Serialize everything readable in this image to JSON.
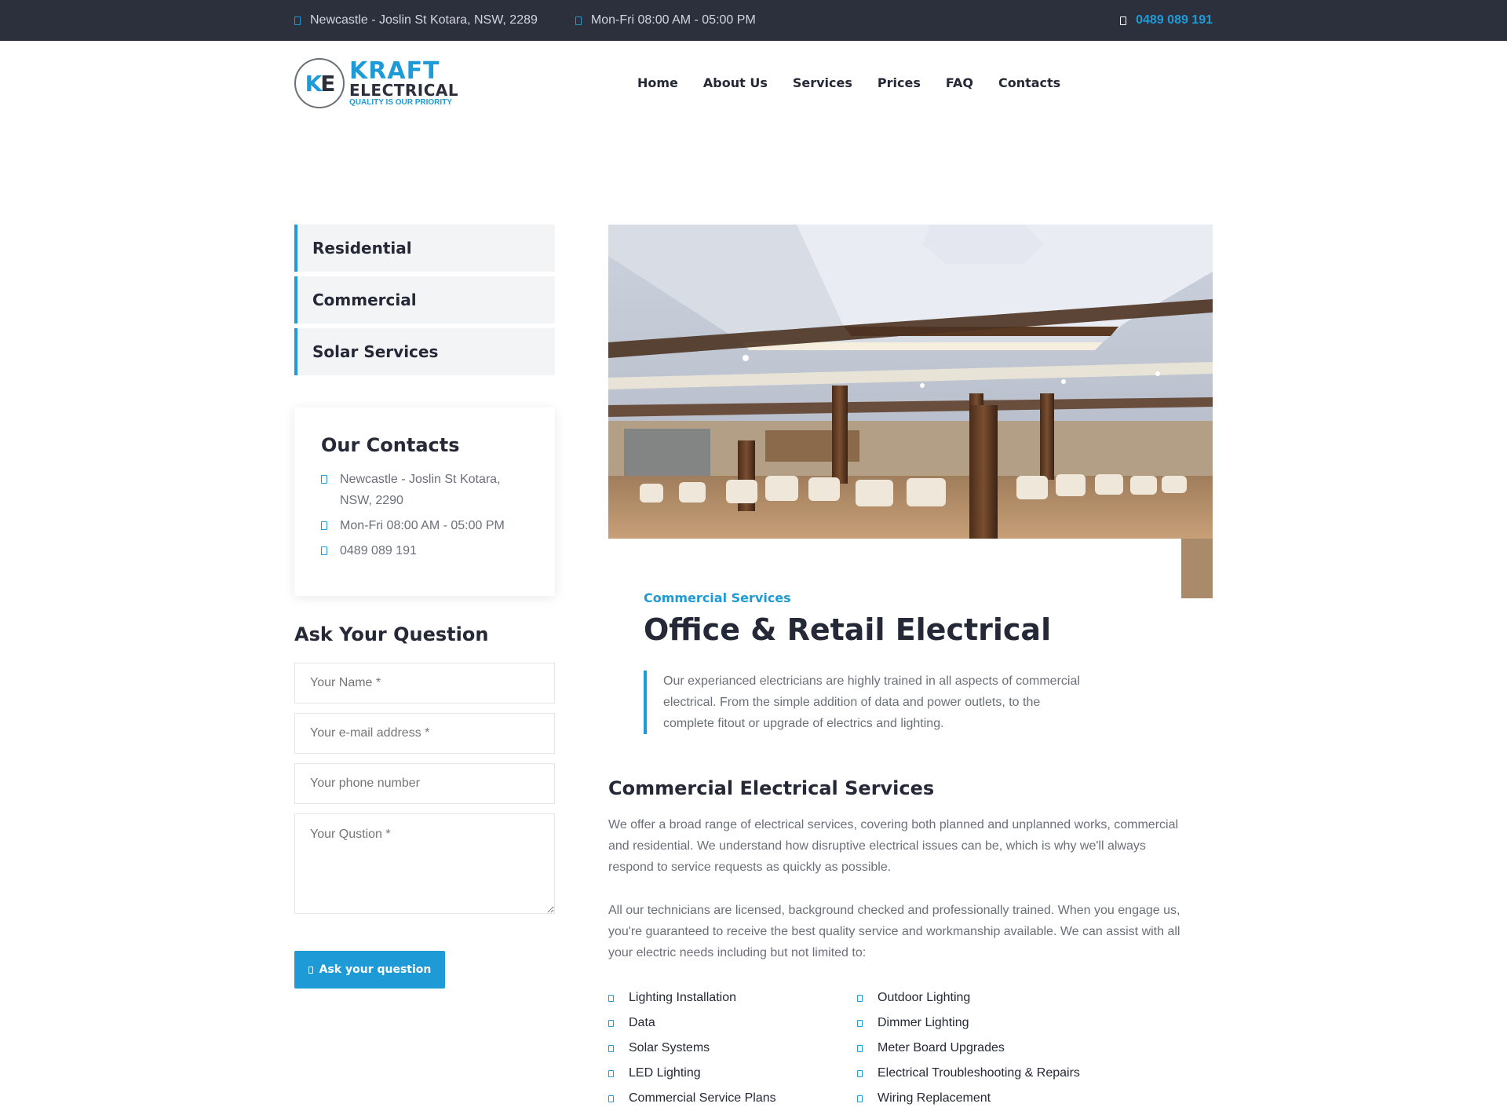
{
  "topbar": {
    "address": "Newcastle - Joslin St Kotara, NSW, 2289",
    "hours": "Mon-Fri 08:00 AM - 05:00 PM",
    "phone": "0489 089 191"
  },
  "logo": {
    "line1": "KRAFT",
    "line2": "ELECTRICAL",
    "line3": "QUALITY IS OUR PRIORITY"
  },
  "nav": [
    "Home",
    "About Us",
    "Services",
    "Prices",
    "FAQ",
    "Contacts"
  ],
  "sidebar": {
    "categories": [
      "Residential",
      "Commercial",
      "Solar Services"
    ],
    "contacts": {
      "title": "Our Contacts",
      "address": "Newcastle - Joslin St Kotara, NSW, 2290",
      "hours": "Mon-Fri 08:00 AM - 05:00 PM",
      "phone": "0489 089 191"
    },
    "form": {
      "title": "Ask Your Question",
      "name_placeholder": "Your Name *",
      "email_placeholder": "Your e-mail address *",
      "phone_placeholder": "Your phone number",
      "question_placeholder": "Your Qustion *",
      "submit_label": "Ask your question"
    }
  },
  "main": {
    "tagline": "Commercial Services",
    "title": "Office & Retail Electrical",
    "quote": "Our experianced electricians are highly trained in all aspects of commercial electrical. From the simple addition of data and power outlets, to the complete fitout or upgrade of electrics and lighting.",
    "section_title": "Commercial Electrical Services",
    "para1": "We offer a broad range of electrical services, covering both planned and unplanned works, commercial and residential. We understand how disruptive electrical issues can be, which is why we'll always respond to service requests as quickly as possible.",
    "para2": "All our technicians are licensed, background checked and professionally trained. When you engage us, you're guaranteed to receive the best quality service and workmanship available. We can assist with all your electric needs including but not limited to:",
    "list_left": [
      "Lighting Installation",
      "Data",
      "Solar Systems",
      "LED Lighting",
      "Commercial Service Plans"
    ],
    "list_right": [
      "Outdoor Lighting",
      "Dimmer Lighting",
      "Meter Board Upgrades",
      "Electrical Troubleshooting & Repairs",
      "Wiring Replacement"
    ]
  },
  "colors": {
    "accent": "#1e9bd7",
    "dark": "#2c2f3c",
    "text": "#252836",
    "muted": "#6b6f78"
  }
}
